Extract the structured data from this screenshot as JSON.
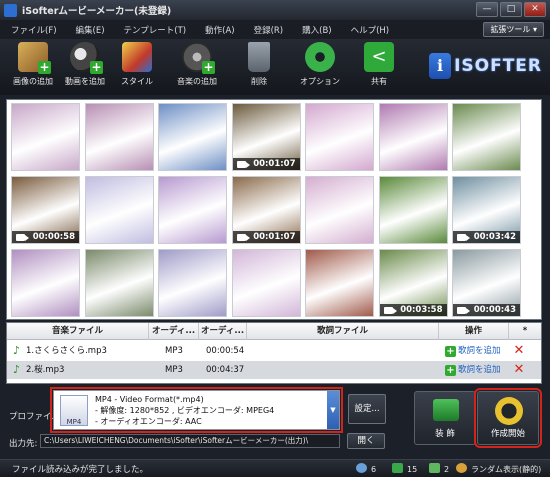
{
  "window": {
    "title": "iSofterムービーメーカー(未登録)",
    "min_label": "—",
    "max_label": "□",
    "close_label": "✕"
  },
  "menu": {
    "items": [
      "ファイル(F)",
      "編集(E)",
      "テンプレート(T)",
      "動作(A)",
      "登録(R)",
      "購入(B)",
      "ヘルプ(H)"
    ],
    "skin_button": "拡張ツール ▾"
  },
  "toolbar": {
    "tools": [
      {
        "label": "画像の追加",
        "icon": "add-image-icon"
      },
      {
        "label": "動画を追加",
        "icon": "add-video-icon"
      },
      {
        "label": "スタイル",
        "icon": "style-icon"
      },
      {
        "label": "音楽の追加",
        "icon": "add-music-icon"
      },
      {
        "label": "削除",
        "icon": "trash-icon"
      },
      {
        "label": "オプション",
        "icon": "gear-icon"
      },
      {
        "label": "共有",
        "icon": "share-icon"
      }
    ],
    "logo_text": "ISOFTER",
    "logo_mark": "i"
  },
  "media": {
    "items": [
      {
        "duration": "",
        "color": "#c7a7c8"
      },
      {
        "duration": "",
        "color": "#b78fb3"
      },
      {
        "duration": "",
        "color": "#6d8fc4"
      },
      {
        "duration": "00:01:07",
        "color": "#6b5a3c"
      },
      {
        "duration": "",
        "color": "#d3a8cf"
      },
      {
        "duration": "",
        "color": "#b07ab0"
      },
      {
        "duration": "",
        "color": "#6a8a4e"
      },
      {
        "duration": "00:00:58",
        "color": "#7a5b3d"
      },
      {
        "duration": "",
        "color": "#c0bde0"
      },
      {
        "duration": "",
        "color": "#b79ad0"
      },
      {
        "duration": "00:01:07",
        "color": "#8a6a4a"
      },
      {
        "duration": "",
        "color": "#d4aed0"
      },
      {
        "duration": "",
        "color": "#5a8a3a"
      },
      {
        "duration": "00:03:42",
        "color": "#6f8fa0"
      },
      {
        "duration": "",
        "color": "#b08fc0"
      },
      {
        "duration": "",
        "color": "#7a8a6a"
      },
      {
        "duration": "",
        "color": "#9f9bc8"
      },
      {
        "duration": "",
        "color": "#d2b6d8"
      },
      {
        "duration": "",
        "color": "#a05a4a"
      },
      {
        "duration": "00:03:58",
        "color": "#6a8a4a"
      },
      {
        "duration": "00:00:43",
        "color": "#8a9aa0"
      }
    ]
  },
  "music_table": {
    "headers": [
      "音楽ファイル",
      "オーディ...",
      "オーディ...",
      "歌詞ファイル",
      "操作",
      "*"
    ],
    "rows": [
      {
        "file": "1.さくらさくら.mp3",
        "format": "MP3",
        "length": "00:00:54",
        "lyric": "",
        "action": "歌詞を追加"
      },
      {
        "file": "2.桜.mp3",
        "format": "MP3",
        "length": "00:04:37",
        "lyric": "",
        "action": "歌詞を追加"
      }
    ]
  },
  "output": {
    "profile_label": "プロファイル:",
    "profile_name": "MP4 - Video Format(*.mp4)",
    "profile_detail_1": "- 解像度: 1280*852 , ビデオエンコーダ: MPEG4",
    "profile_detail_2": "- オーディオエンコーダ: AAC",
    "settings_button": "設定...",
    "output_label": "出力先:",
    "output_path": "C:\\Users\\LIWEICHENG\\Documents\\iSofter\\iSofterムービーメーカー(出力)\\",
    "open_button": "開く",
    "decorate_button": "装 飾",
    "create_button": "作成開始"
  },
  "status": {
    "message": "ファイル読み込みが完了しました。",
    "photo_count": "6",
    "video_count": "15",
    "music_count": "2",
    "mode": "ランダム表示(静的)"
  },
  "colors": {
    "accent_green": "#2faa2f",
    "highlight_red": "#d3241c",
    "link_blue": "#1b5fbf"
  }
}
